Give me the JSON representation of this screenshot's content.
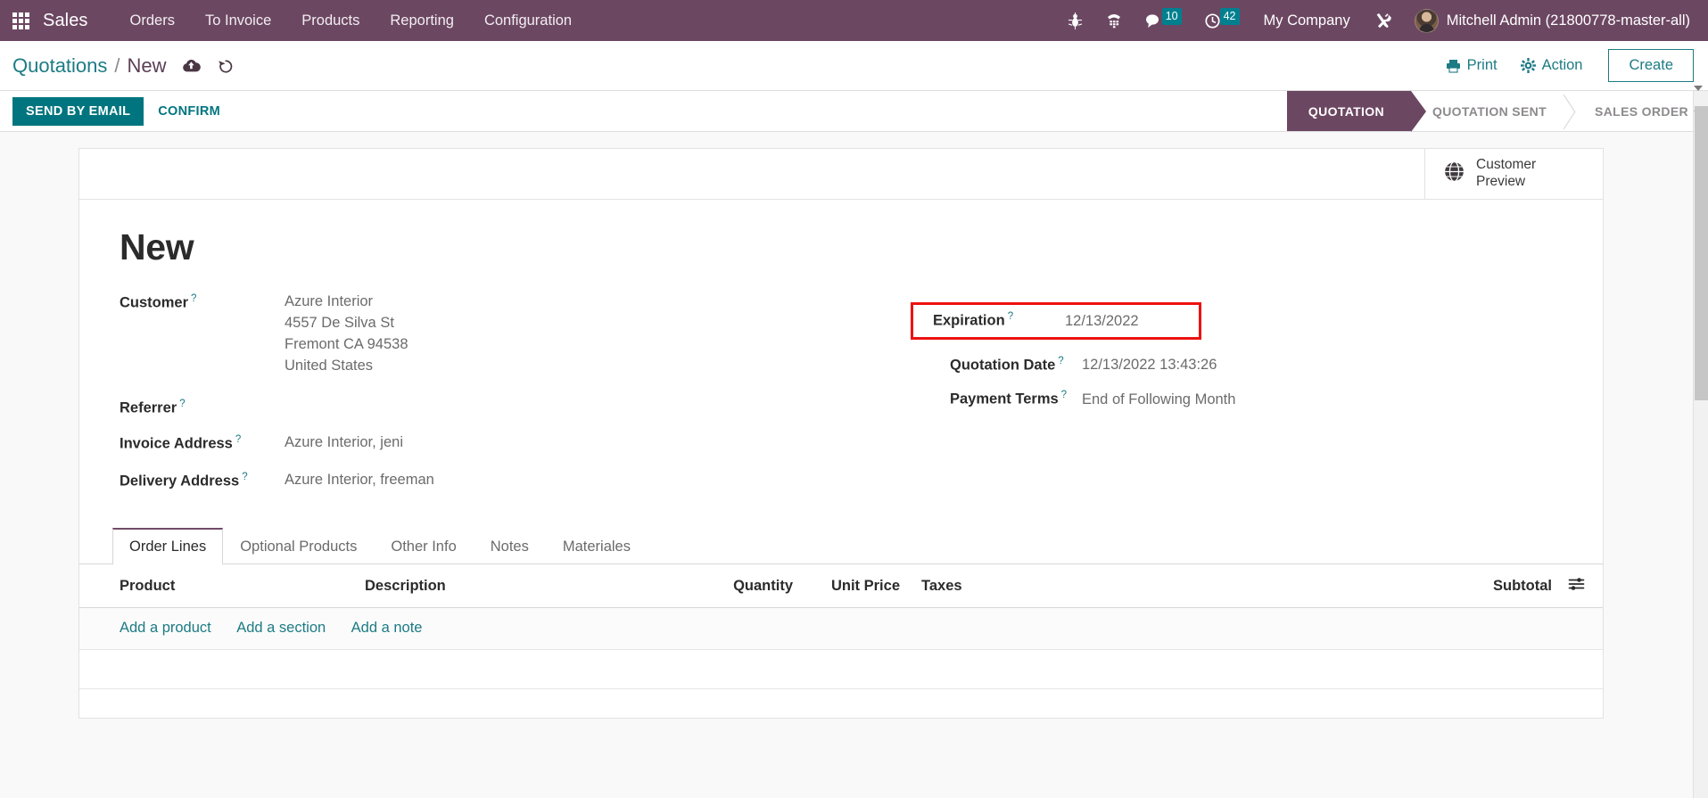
{
  "navbar": {
    "apps_icon": "grid-apps-icon",
    "brand": "Sales",
    "menu": [
      {
        "label": "Orders"
      },
      {
        "label": "To Invoice"
      },
      {
        "label": "Products"
      },
      {
        "label": "Reporting"
      },
      {
        "label": "Configuration"
      }
    ],
    "sys_icons": [
      {
        "name": "bug-icon"
      },
      {
        "name": "dialpad-phone-icon"
      },
      {
        "name": "messages-icon",
        "badge": "10"
      },
      {
        "name": "activities-clock-icon",
        "badge": "42"
      }
    ],
    "messages_count": "10",
    "activities_count": "42",
    "company": "My Company",
    "tools_icon": "wrench-screwdriver-icon",
    "user": "Mitchell Admin (21800778-master-all)",
    "bg_color": "#6c4762"
  },
  "control_panel": {
    "breadcrumb_root": "Quotations",
    "breadcrumb_sep": "/",
    "breadcrumb_current": "New",
    "save_icon": "cloud-upload-icon",
    "discard_icon": "undo-icon",
    "print_label": "Print",
    "action_label": "Action",
    "create_label": "Create",
    "accent_color": "#1d7b84"
  },
  "statusbar": {
    "buttons": [
      {
        "label": "SEND BY EMAIL",
        "primary": true
      },
      {
        "label": "CONFIRM",
        "primary": false
      }
    ],
    "stages": [
      {
        "label": "QUOTATION",
        "active": true
      },
      {
        "label": "QUOTATION SENT",
        "active": false
      },
      {
        "label": "SALES ORDER",
        "active": false
      }
    ],
    "active_color": "#6c4762"
  },
  "sheet": {
    "stat_button": {
      "label": "Customer\nPreview",
      "label_line1": "Customer",
      "label_line2": "Preview",
      "icon": "globe-icon"
    },
    "title": "New",
    "left_fields": [
      {
        "label": "Customer",
        "help": "?",
        "value_lines": [
          "Azure Interior",
          "4557 De Silva St",
          "Fremont CA 94538",
          "United States"
        ]
      },
      {
        "label": "Referrer",
        "help": "?",
        "value_lines": []
      },
      {
        "label": "Invoice Address",
        "help": "?",
        "value_lines": [
          "Azure Interior, jeni"
        ]
      },
      {
        "label": "Delivery Address",
        "help": "?",
        "value_lines": [
          "Azure Interior, freeman"
        ]
      }
    ],
    "right_fields": [
      {
        "label": "Expiration",
        "help": "?",
        "value": "12/13/2022",
        "highlighted": true
      },
      {
        "label": "Quotation Date",
        "help": "?",
        "value": "12/13/2022 13:43:26",
        "highlighted": false
      },
      {
        "label": "Payment Terms",
        "help": "?",
        "value": "End of Following Month",
        "highlighted": false
      }
    ],
    "highlight_color": "#ee1111"
  },
  "notebook": {
    "tabs": [
      {
        "label": "Order Lines",
        "active": true
      },
      {
        "label": "Optional Products",
        "active": false
      },
      {
        "label": "Other Info",
        "active": false
      },
      {
        "label": "Notes",
        "active": false
      },
      {
        "label": "Materiales",
        "active": false
      }
    ],
    "columns": {
      "product": "Product",
      "description": "Description",
      "quantity": "Quantity",
      "unit_price": "Unit Price",
      "taxes": "Taxes",
      "subtotal": "Subtotal",
      "optional_icon": "column-options-sliders-icon"
    },
    "rows": [],
    "add_links": [
      {
        "label": "Add a product"
      },
      {
        "label": "Add a section"
      },
      {
        "label": "Add a note"
      }
    ]
  }
}
